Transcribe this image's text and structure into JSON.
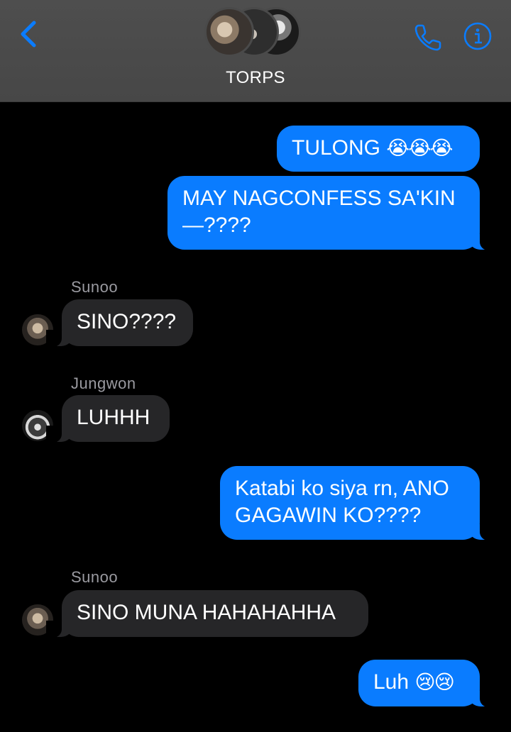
{
  "header": {
    "title": "TORPS",
    "back_icon": "chevron-left-icon",
    "call_icon": "phone-icon",
    "info_icon": "info-icon",
    "accent_color": "#0a7cff"
  },
  "messages": [
    {
      "direction": "outgoing",
      "text": "TULONG",
      "emoji": "😭😭😭"
    },
    {
      "direction": "outgoing",
      "text_line1": "MAY NAGCONFESS SA'KIN",
      "text_line2": "—????"
    },
    {
      "direction": "incoming",
      "sender": "Sunoo",
      "text": "SINO????"
    },
    {
      "direction": "incoming",
      "sender": "Jungwon",
      "text": "LUHHH"
    },
    {
      "direction": "outgoing",
      "text_line1": "Katabi ko siya rn, ANO",
      "text_line2": "GAGAWIN KO????"
    },
    {
      "direction": "incoming",
      "sender": "Sunoo",
      "text": "SINO MUNA HAHAHAHHA"
    },
    {
      "direction": "outgoing",
      "text": "Luh",
      "emoji": "😢😢"
    }
  ],
  "colors": {
    "outgoing_bubble": "#0a7cff",
    "incoming_bubble": "#262628",
    "background": "#000000",
    "header_bg": "#4a4a4a"
  }
}
